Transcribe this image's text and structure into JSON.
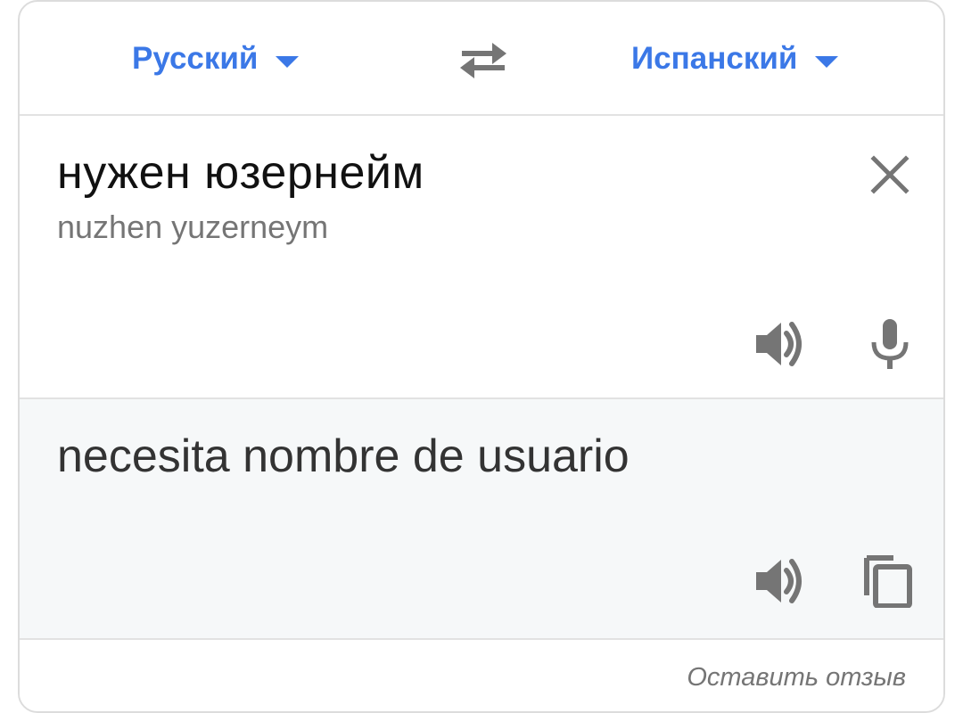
{
  "languages": {
    "source": "Русский",
    "target": "Испанский"
  },
  "input": {
    "text": "нужен юзернейм",
    "transliteration": "nuzhen yuzerneym"
  },
  "output": {
    "text": "necesita nombre de usuario"
  },
  "footer": {
    "feedback": "Оставить отзыв"
  },
  "colors": {
    "accent": "#3b78e7",
    "icon": "#757575",
    "output_bg": "#f6f8f9"
  },
  "icons": {
    "swap": "swap-icon",
    "clear": "close-icon",
    "speak": "speaker-icon",
    "mic": "microphone-icon",
    "copy": "copy-icon"
  }
}
